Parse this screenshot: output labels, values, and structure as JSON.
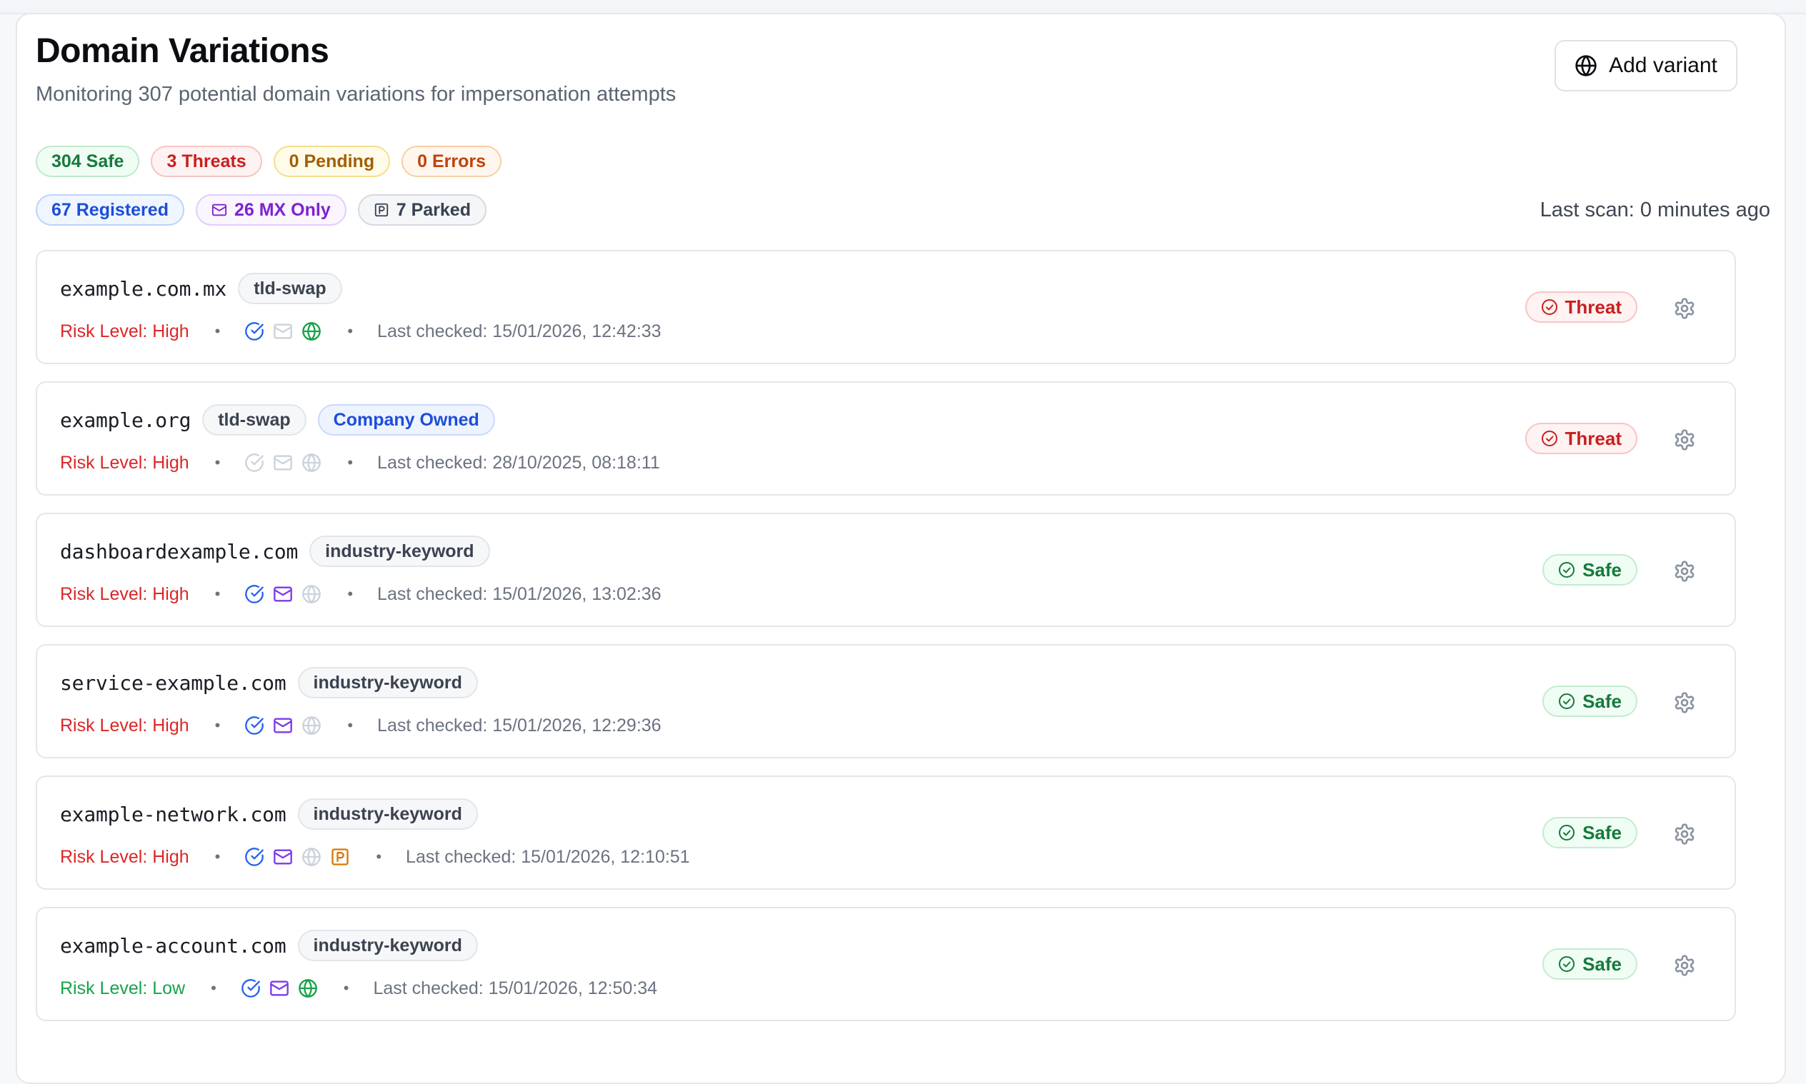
{
  "header": {
    "title": "Domain Variations",
    "subtitle": "Monitoring 307 potential domain variations for impersonation attempts",
    "add_button_label": "Add variant"
  },
  "summary": {
    "safe": "304 Safe",
    "threats": "3 Threats",
    "pending": "0 Pending",
    "errors": "0 Errors"
  },
  "counts": {
    "registered": "67 Registered",
    "mx_only": "26 MX Only",
    "parked": "7 Parked"
  },
  "last_scan": "Last scan: 0 minutes ago",
  "colors": {
    "threat": "#dc2626",
    "safe": "#16a34a",
    "registered_blue": "#2563eb",
    "mx_purple": "#7c3aed",
    "web_green": "#16a34a",
    "parked_orange": "#d97706",
    "inactive_gray": "#cbd2db"
  },
  "domains": [
    {
      "name": "example.com.mx",
      "tags": [
        "tld-swap"
      ],
      "risk": "Risk Level: High",
      "last_checked": "Last checked: 15/01/2026, 12:42:33",
      "status": "Threat",
      "icons": {
        "registered": true,
        "mx": false,
        "web": true,
        "parked": false
      }
    },
    {
      "name": "example.org",
      "tags": [
        "tld-swap"
      ],
      "owned_label": "Company Owned",
      "risk": "Risk Level: High",
      "last_checked": "Last checked: 28/10/2025, 08:18:11",
      "status": "Threat",
      "icons": {
        "registered": false,
        "mx": false,
        "web": false,
        "parked": false
      }
    },
    {
      "name": "dashboardexample.com",
      "tags": [
        "industry-keyword"
      ],
      "risk": "Risk Level: High",
      "last_checked": "Last checked: 15/01/2026, 13:02:36",
      "status": "Safe",
      "icons": {
        "registered": true,
        "mx": true,
        "web": false,
        "parked": false
      }
    },
    {
      "name": "service-example.com",
      "tags": [
        "industry-keyword"
      ],
      "risk": "Risk Level: High",
      "last_checked": "Last checked: 15/01/2026, 12:29:36",
      "status": "Safe",
      "icons": {
        "registered": true,
        "mx": true,
        "web": false,
        "parked": false
      }
    },
    {
      "name": "example-network.com",
      "tags": [
        "industry-keyword"
      ],
      "risk": "Risk Level: High",
      "last_checked": "Last checked: 15/01/2026, 12:10:51",
      "status": "Safe",
      "icons": {
        "registered": true,
        "mx": true,
        "web": false,
        "parked": true
      }
    },
    {
      "name": "example-account.com",
      "tags": [
        "industry-keyword"
      ],
      "risk": "Risk Level: Low",
      "last_checked": "Last checked: 15/01/2026, 12:50:34",
      "status": "Safe",
      "icons": {
        "registered": true,
        "mx": true,
        "web": true,
        "parked": false
      }
    }
  ]
}
